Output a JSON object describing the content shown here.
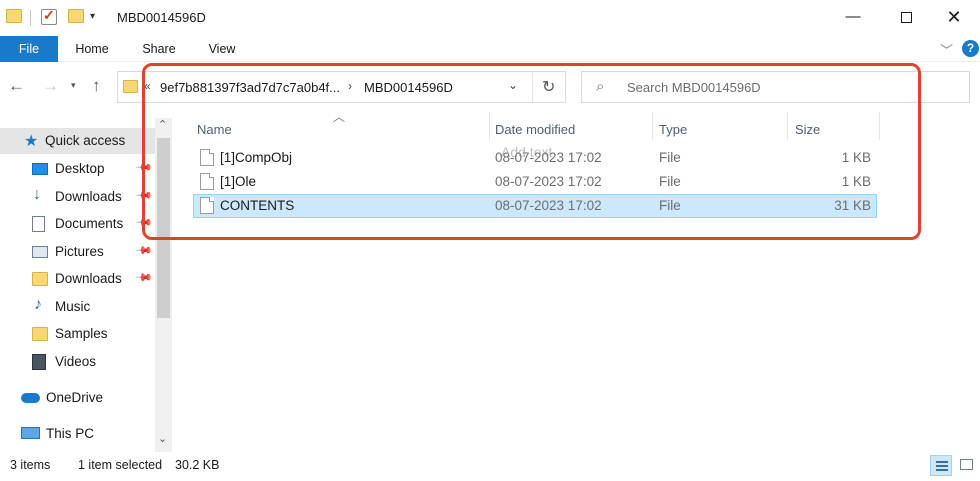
{
  "window": {
    "title": "MBD0014596D",
    "minimize": "—",
    "close": "✕"
  },
  "ribbon": {
    "tabs": [
      "File",
      "Home",
      "Share",
      "View"
    ],
    "help": "?"
  },
  "address": {
    "segments": [
      "9ef7b881397f3ad7d7c7a0b4f...",
      "MBD0014596D"
    ]
  },
  "search": {
    "placeholder": "Search MBD0014596D"
  },
  "navpane": {
    "items": [
      {
        "label": "Quick access",
        "icon": "star-icon",
        "pinned": false
      },
      {
        "label": "Desktop",
        "icon": "desktop-icon",
        "pinned": true
      },
      {
        "label": "Downloads",
        "icon": "download-icon",
        "pinned": true
      },
      {
        "label": "Documents",
        "icon": "documents-icon",
        "pinned": true
      },
      {
        "label": "Pictures",
        "icon": "pictures-icon",
        "pinned": true
      },
      {
        "label": "Downloads",
        "icon": "folder-icon",
        "pinned": true
      },
      {
        "label": "Music",
        "icon": "music-icon",
        "pinned": false
      },
      {
        "label": "Samples",
        "icon": "folder-icon",
        "pinned": false
      },
      {
        "label": "Videos",
        "icon": "videos-icon",
        "pinned": false
      },
      {
        "label": "OneDrive",
        "icon": "cloud-icon",
        "pinned": false
      },
      {
        "label": "This PC",
        "icon": "computer-icon",
        "pinned": false
      }
    ]
  },
  "columns": {
    "name": "Name",
    "date": "Date modified",
    "type": "Type",
    "size": "Size"
  },
  "files": [
    {
      "name": "[1]CompObj",
      "date": "08-07-2023 17:02",
      "type": "File",
      "size": "1 KB",
      "selected": false
    },
    {
      "name": "[1]Ole",
      "date": "08-07-2023 17:02",
      "type": "File",
      "size": "1 KB",
      "selected": false
    },
    {
      "name": "CONTENTS",
      "date": "08-07-2023 17:02",
      "type": "File",
      "size": "31 KB",
      "selected": true
    }
  ],
  "overlay_text": "Add text",
  "status": {
    "items": "3 items",
    "selected": "1 item selected",
    "size": "30.2 KB"
  },
  "colors": {
    "accent": "#1979ca",
    "selection": "#cce8ff",
    "highlight_border": "#e0432b"
  }
}
